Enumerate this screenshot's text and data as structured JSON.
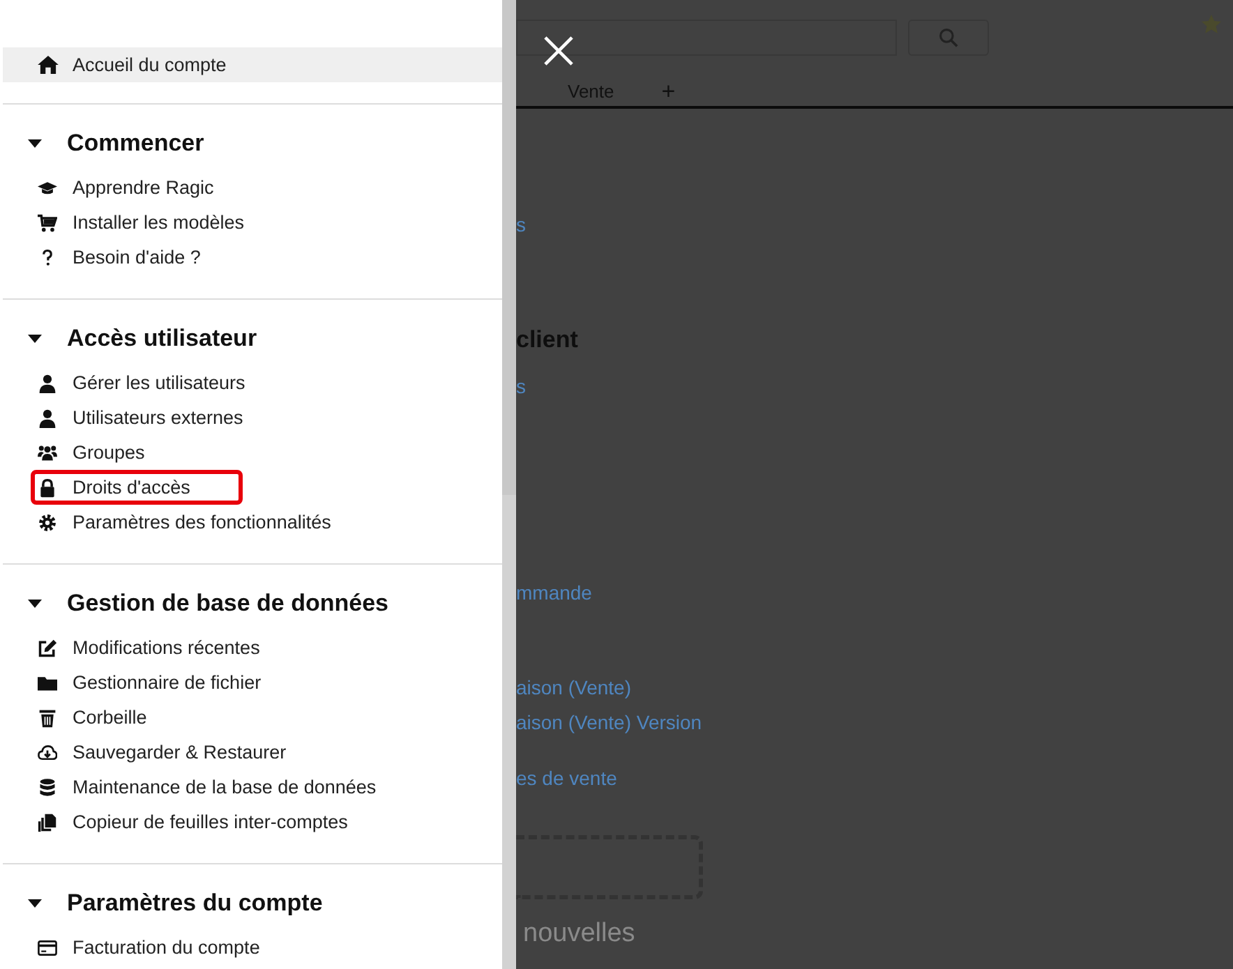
{
  "sidebar": {
    "home": {
      "label": "Accueil du compte",
      "selected": true
    },
    "sections": [
      {
        "title": "Commencer",
        "expanded": true,
        "items": [
          {
            "label": "Apprendre Ragic",
            "highlighted": false
          },
          {
            "label": "Installer les modèles",
            "highlighted": false
          },
          {
            "label": "Besoin d'aide ?",
            "highlighted": false
          }
        ]
      },
      {
        "title": "Accès utilisateur",
        "expanded": true,
        "items": [
          {
            "label": "Gérer les utilisateurs",
            "highlighted": false
          },
          {
            "label": "Utilisateurs externes",
            "highlighted": false
          },
          {
            "label": "Groupes",
            "highlighted": false
          },
          {
            "label": "Droits d'accès",
            "highlighted": true
          },
          {
            "label": "Paramètres des fonctionnalités",
            "highlighted": false
          }
        ]
      },
      {
        "title": "Gestion de base de données",
        "expanded": true,
        "items": [
          {
            "label": "Modifications récentes",
            "highlighted": false
          },
          {
            "label": "Gestionnaire de fichier",
            "highlighted": false
          },
          {
            "label": "Corbeille",
            "highlighted": false
          },
          {
            "label": "Sauvegarder & Restaurer",
            "highlighted": false
          },
          {
            "label": "Maintenance de la base de données",
            "highlighted": false
          },
          {
            "label": "Copieur de feuilles inter-comptes",
            "highlighted": false
          }
        ]
      },
      {
        "title": "Paramètres du compte",
        "expanded": true,
        "items": [
          {
            "label": "Facturation du compte",
            "highlighted": false
          }
        ]
      }
    ]
  },
  "background": {
    "tabs": [
      {
        "label": "Vente"
      },
      {
        "label": "+"
      }
    ],
    "texts": [
      {
        "kind": "link",
        "text": "s"
      },
      {
        "kind": "heading",
        "text": "client"
      },
      {
        "kind": "link",
        "text": "s"
      },
      {
        "kind": "link",
        "text": "mmande"
      },
      {
        "kind": "link",
        "text": "aison (Vente)"
      },
      {
        "kind": "link",
        "text": "aison (Vente) Version"
      },
      {
        "kind": "link",
        "text": "es de vente"
      },
      {
        "kind": "dropzone"
      },
      {
        "kind": "faded",
        "text": "nouvelles"
      }
    ]
  }
}
